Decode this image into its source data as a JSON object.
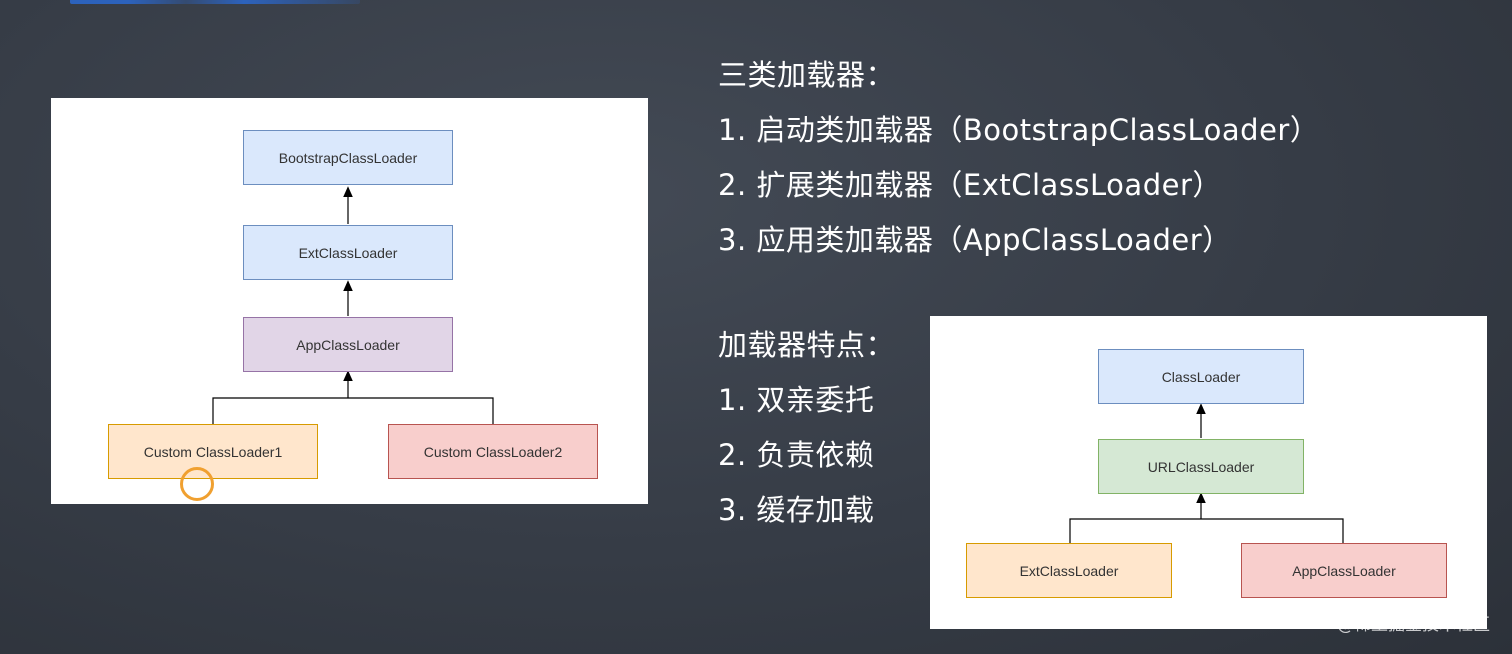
{
  "left_diagram": {
    "nodes": {
      "bootstrap": "BootstrapClassLoader",
      "ext": "ExtClassLoader",
      "app": "AppClassLoader",
      "custom1": "Custom ClassLoader1",
      "custom2": "Custom ClassLoader2"
    }
  },
  "loader_types": {
    "heading": "三类加载器：",
    "items": [
      "1. 启动类加载器（BootstrapClassLoader）",
      "2. 扩展类加载器（ExtClassLoader）",
      "3. 应用类加载器（AppClassLoader）"
    ]
  },
  "loader_features": {
    "heading": "加载器特点：",
    "items": [
      "1. 双亲委托",
      "2. 负责依赖",
      "3. 缓存加载"
    ]
  },
  "right_diagram": {
    "nodes": {
      "classloader": "ClassLoader",
      "url": "URLClassLoader",
      "ext": "ExtClassLoader",
      "app": "AppClassLoader"
    }
  },
  "watermark": "@稀土掘金技术社区",
  "colors": {
    "background": "#363c46",
    "node_blue": "#dae8fc",
    "node_purple": "#e1d5e7",
    "node_orange": "#ffe6cc",
    "node_red": "#f8cecc",
    "node_green": "#d5e8d4",
    "cursor_ring": "#f0a030"
  }
}
